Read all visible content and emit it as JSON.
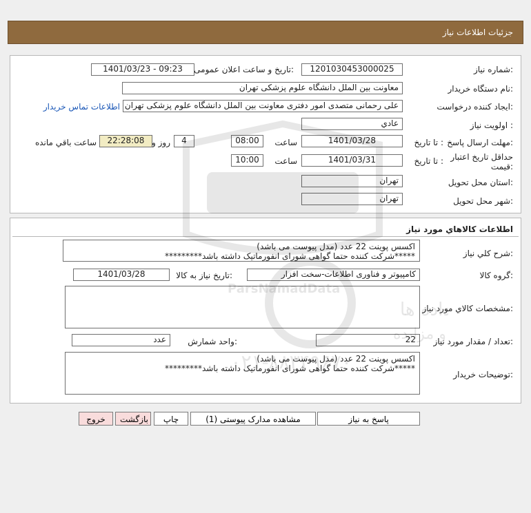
{
  "page": {
    "title": "جزئیات اطلاعات نیاز"
  },
  "details": {
    "need_number_label": "شماره نیاز:",
    "need_number": "1201030453000025",
    "announce_label": "تاریخ و ساعت اعلان عمومی:",
    "announce_value": "1401/03/23 - 09:23",
    "buyer_org_label": "نام دستگاه خریدار:",
    "buyer_org": "معاونت بین الملل دانشگاه علوم پزشکی تهران",
    "requester_label": "ایجاد کننده درخواست:",
    "requester": "علی رحمانی متصدی امور دفتری معاونت بین الملل دانشگاه علوم پزشکی تهران",
    "contact_link": "اطلاعات تماس خریدار",
    "priority_label": "اولویت نیاز :",
    "priority": "عادي",
    "deadline_label": "مهلت ارسال پاسخ:",
    "to_date_label": "تا تاریخ :",
    "deadline_date": "1401/03/28",
    "time_label": "ساعت",
    "deadline_time": "08:00",
    "days_value": "4",
    "days_and_label": "روز و",
    "remaining_time": "22:28:08",
    "remaining_label": "ساعت باقي مانده",
    "validity_label": "حداقل تاریخ اعتبار قیمت:",
    "validity_date": "1401/03/31",
    "validity_time": "10:00",
    "province_label": "استان محل تحویل:",
    "province": "تهران",
    "city_label": "شهر محل تحویل:",
    "city": "تهران"
  },
  "goods": {
    "section_title": "اطلاعات کالاهاي مورد نياز",
    "general_desc_label": "شرح کلي نياز:",
    "general_desc_lines": [
      "اکسس پوینت 22 عدد (مدل پیوست می باشد)",
      "*****شرکت کننده حتما گواهی شورای انفورماتیک داشته باشد*********"
    ],
    "group_label": "گروه کالا:",
    "group": "کامپیوتر و فناوری اطلاعات-سخت افزار",
    "need_date_label": "تاریخ نیاز به کالا:",
    "need_date": "1401/03/28",
    "specs_label": "مشخصات کالاي مورد نياز:",
    "qty_label": "تعداد / مقدار مورد نیاز:",
    "qty": "22",
    "unit_label": "واحد شمارش:",
    "unit": "عدد",
    "buyer_notes_label": "توضیحات خریدار:",
    "buyer_notes_lines": [
      "اکسس پوینت 22 عدد (مدل پیوست می باشد)",
      "*****شرکت کننده حتما گواهی شورای انفورماتیک داشته باشد*********"
    ]
  },
  "buttons": {
    "reply": "پاسخ به نیاز",
    "attachments": "مشاهده مدارک پیوستی (1)",
    "print": "چاپ",
    "back": "بازگشت",
    "exit": "خروج"
  },
  "watermark": {
    "line1": "مرکز فرآوری اطلاعات پارس نماد داده ها",
    "line2": "پایگاه اطلاع رسانی مناقصه و مزایده",
    "line3": "۰۲۱-۸۸۳۴۹۶۷۰",
    "brand": "ParsNamadData"
  },
  "colors": {
    "header_bg": "#8f6a3e",
    "remaining_bg": "#f2ecc3",
    "link": "#1a57b7",
    "exit_bg": "#f9dcdc"
  }
}
